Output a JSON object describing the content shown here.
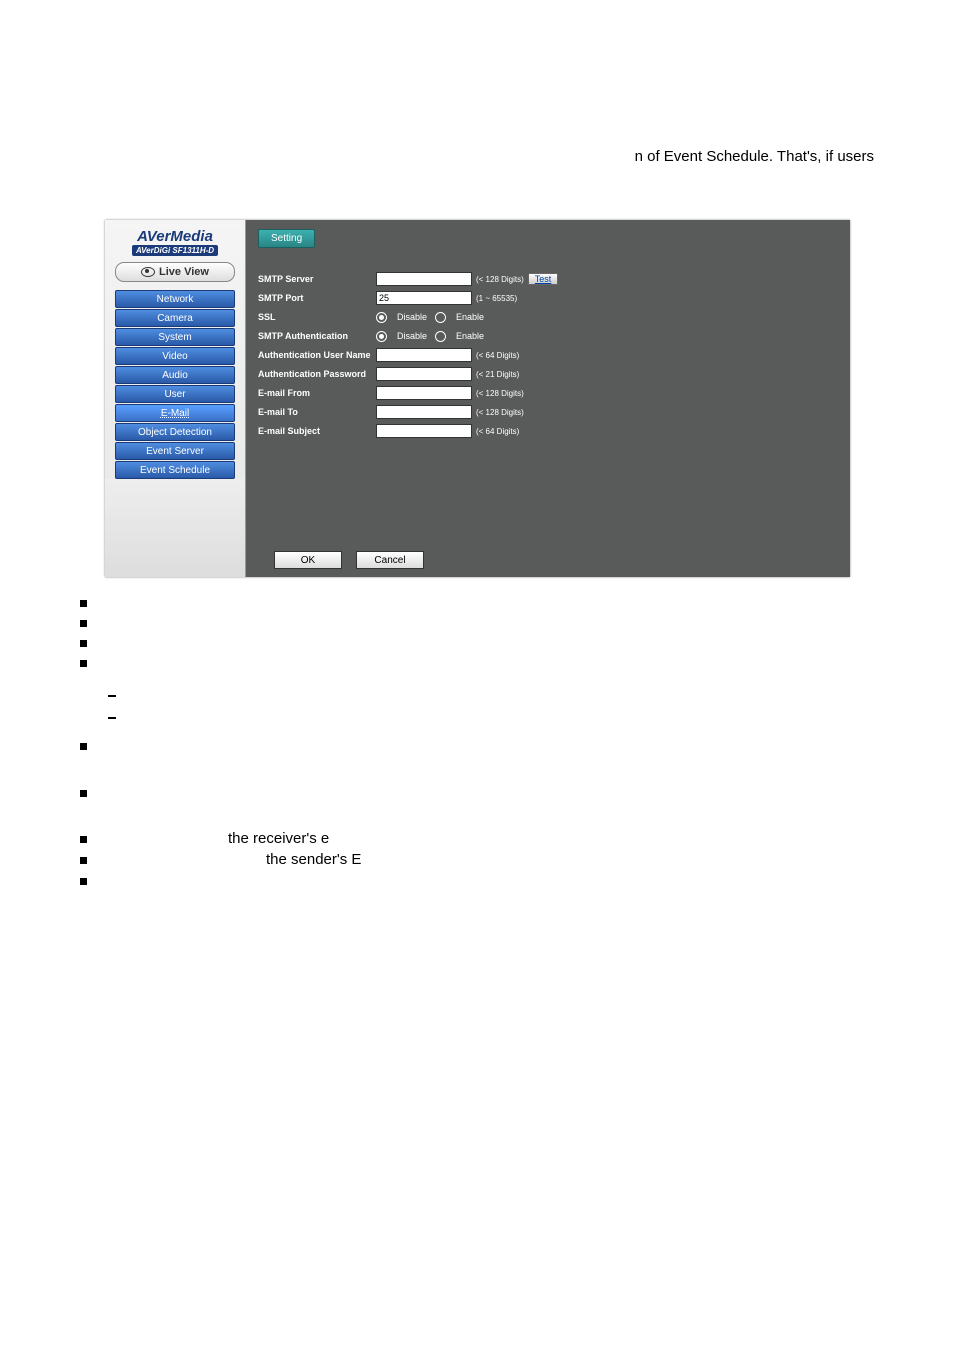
{
  "top_text": "n of Event Schedule. That's, if users",
  "brand": "AVerMedia",
  "brand_sub": "AVerDiGi SF1311H-D",
  "live_view": "Live View",
  "nav": {
    "items": [
      {
        "label": "Network"
      },
      {
        "label": "Camera"
      },
      {
        "label": "System"
      },
      {
        "label": "Video"
      },
      {
        "label": "Audio"
      },
      {
        "label": "User"
      },
      {
        "label": "E-Mail"
      },
      {
        "label": "Object Detection"
      },
      {
        "label": "Event Server"
      },
      {
        "label": "Event Schedule"
      }
    ]
  },
  "tab_label": "Setting",
  "form": {
    "smtp_server": {
      "label": "SMTP Server",
      "value": "",
      "hint": "(< 128 Digits)",
      "test": "Test"
    },
    "smtp_port": {
      "label": "SMTP Port",
      "value": "25",
      "hint": "(1 ~ 65535)"
    },
    "ssl": {
      "label": "SSL",
      "disable": "Disable",
      "enable": "Enable",
      "checked": "disable"
    },
    "smtp_auth": {
      "label": "SMTP Authentication",
      "disable": "Disable",
      "enable": "Enable",
      "checked": "disable"
    },
    "auth_user": {
      "label": "Authentication User Name",
      "value": "",
      "hint": "(< 64 Digits)"
    },
    "auth_pass": {
      "label": "Authentication Password",
      "value": "",
      "hint": "(< 21 Digits)"
    },
    "email_from": {
      "label": "E-mail From",
      "value": "",
      "hint": "(< 128 Digits)"
    },
    "email_to": {
      "label": "E-mail To",
      "value": "",
      "hint": "(< 128 Digits)"
    },
    "email_subject": {
      "label": "E-mail Subject",
      "value": "",
      "hint": "(< 64 Digits)"
    }
  },
  "ok": "OK",
  "cancel": "Cancel",
  "line7": "the receiver's e",
  "line8": "the sender's E"
}
